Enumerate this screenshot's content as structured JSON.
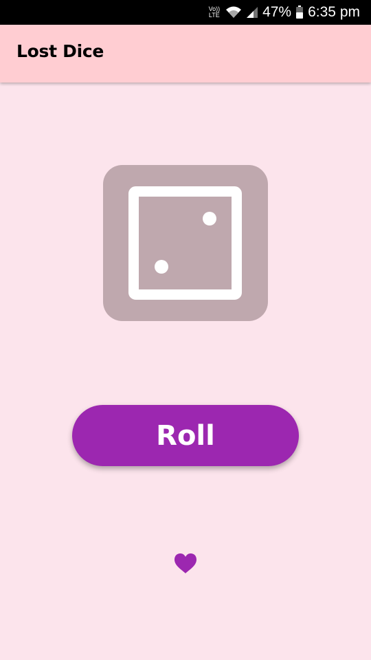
{
  "status_bar": {
    "volte_top": "Vo))",
    "volte_bottom": "LTE",
    "battery_percent": "47%",
    "time": "6:35 pm",
    "icons": [
      "volte-icon",
      "wifi-icon",
      "signal-icon",
      "battery-icon"
    ]
  },
  "app_bar": {
    "title": "Lost Dice",
    "background": "#ffcdd2"
  },
  "dice": {
    "face_value": 2,
    "icon": "dice-two-icon",
    "background": "#bfa8ae"
  },
  "roll_button": {
    "label": "Roll",
    "color": "#9c27b0"
  },
  "footer": {
    "icon": "heart-icon",
    "color": "#9c27b0"
  },
  "colors": {
    "page_background": "#fce4ec",
    "accent": "#9c27b0"
  }
}
